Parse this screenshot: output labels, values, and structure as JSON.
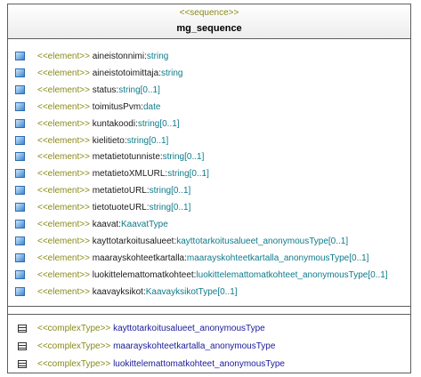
{
  "class": {
    "stereotype": "<<sequence>>",
    "name": "mg_sequence"
  },
  "elements": [
    {
      "stereotype": "<<element>>",
      "name": "aineistonnimi:",
      "type": "string"
    },
    {
      "stereotype": "<<element>>",
      "name": "aineistotoimittaja:",
      "type": "string"
    },
    {
      "stereotype": "<<element>>",
      "name": "status:",
      "type": "string[0..1]"
    },
    {
      "stereotype": "<<element>>",
      "name": "toimitusPvm:",
      "type": "date"
    },
    {
      "stereotype": "<<element>>",
      "name": "kuntakoodi:",
      "type": "string[0..1]"
    },
    {
      "stereotype": "<<element>>",
      "name": "kielitieto:",
      "type": "string[0..1]"
    },
    {
      "stereotype": "<<element>>",
      "name": "metatietotunniste:",
      "type": "string[0..1]"
    },
    {
      "stereotype": "<<element>>",
      "name": "metatietoXMLURL:",
      "type": "string[0..1]"
    },
    {
      "stereotype": "<<element>>",
      "name": "metatietoURL:",
      "type": "string[0..1]"
    },
    {
      "stereotype": "<<element>>",
      "name": "tietotuoteURL:",
      "type": "string[0..1]"
    },
    {
      "stereotype": "<<element>>",
      "name": "kaavat:",
      "type": "KaavatType"
    },
    {
      "stereotype": "<<element>>",
      "name": "kayttotarkoitusalueet:",
      "type": "kayttotarkoitusalueet_anonymousType[0..1]"
    },
    {
      "stereotype": "<<element>>",
      "name": "maarayskohteetkartalla:",
      "type": "maarayskohteetkartalla_anonymousType[0..1]"
    },
    {
      "stereotype": "<<element>>",
      "name": "luokittelemattomatkohteet:",
      "type": "luokittelemattomatkohteet_anonymousType[0..1]"
    },
    {
      "stereotype": "<<element>>",
      "name": "kaavayksikot:",
      "type": "KaavayksikotType[0..1]"
    }
  ],
  "complexTypes": [
    {
      "stereotype": "<<complexType>>",
      "name": "kayttotarkoitusalueet_anonymousType"
    },
    {
      "stereotype": "<<complexType>>",
      "name": "maarayskohteetkartalla_anonymousType"
    },
    {
      "stereotype": "<<complexType>>",
      "name": "luokittelemattomatkohteet_anonymousType"
    }
  ]
}
